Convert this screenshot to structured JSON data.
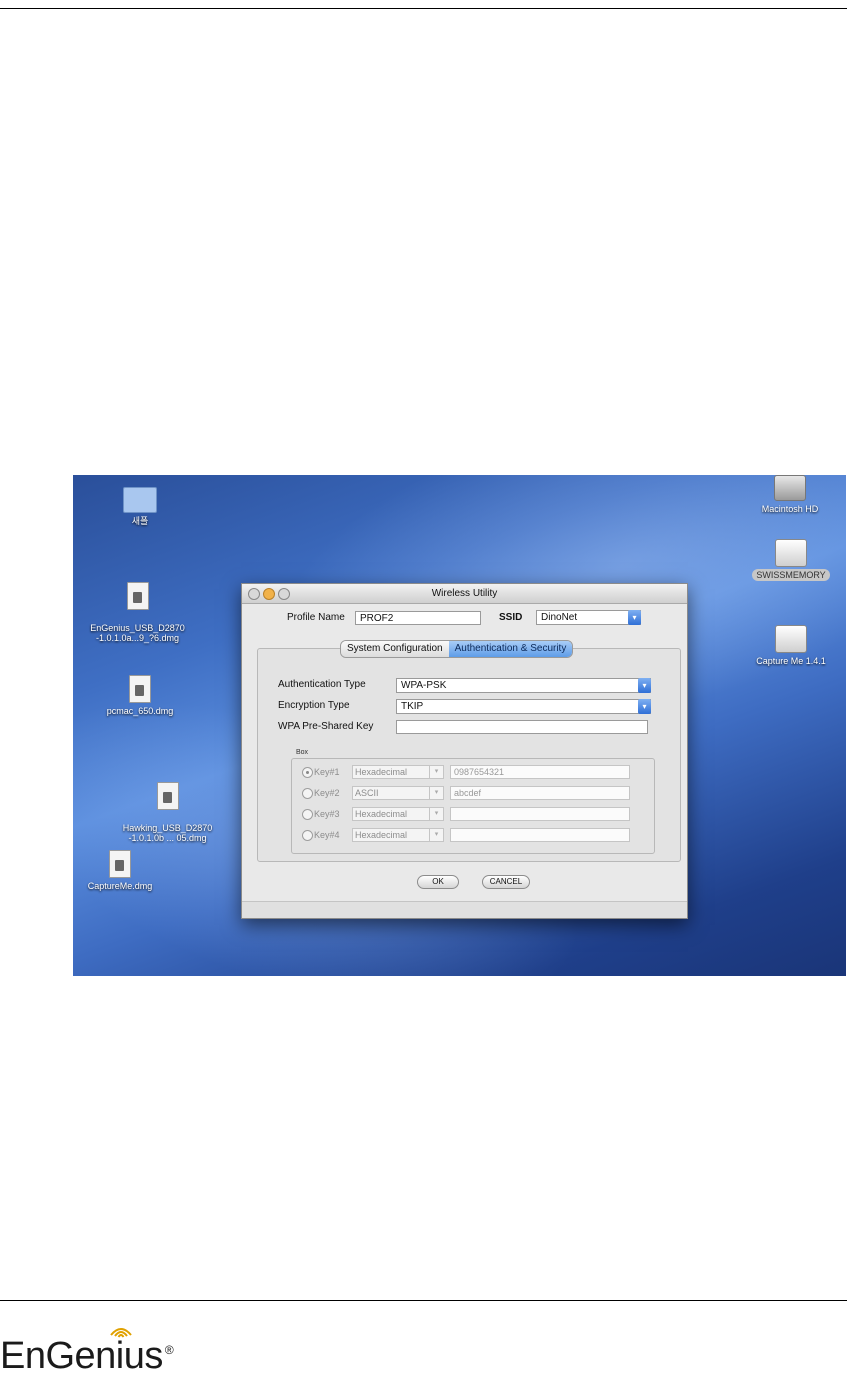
{
  "window": {
    "title": "Wireless Utility",
    "profile_name_label": "Profile Name",
    "profile_name_value": "PROF2",
    "ssid_label": "SSID",
    "ssid_value": "DinoNet",
    "tabs": [
      {
        "label": "System Configuration",
        "active": false
      },
      {
        "label": "Authentication & Security",
        "active": true
      }
    ],
    "auth_type_label": "Authentication Type",
    "auth_type_value": "WPA-PSK",
    "encryption_type_label": "Encryption Type",
    "encryption_type_value": "TKIP",
    "psk_label": "WPA Pre-Shared Key",
    "psk_value": "",
    "box_label": "Box",
    "keys": [
      {
        "label": "Key#1",
        "format": "Hexadecimal",
        "value": "0987654321",
        "selected": true
      },
      {
        "label": "Key#2",
        "format": "ASCII",
        "value": "abcdef",
        "selected": false
      },
      {
        "label": "Key#3",
        "format": "Hexadecimal",
        "value": "",
        "selected": false
      },
      {
        "label": "Key#4",
        "format": "Hexadecimal",
        "value": "",
        "selected": false
      }
    ],
    "ok_label": "OK",
    "cancel_label": "CANCEL"
  },
  "desktop_icons": {
    "folder": "새폴",
    "engenius_dmg": "EnGenius_USB_D2870\n-1.0.1.0a...9_?6.dmg",
    "pcmac_dmg": "pcmac_650.dmg",
    "hawking_dmg": "Hawking_USB_D2870\n-1.0.1.0b ... 05.dmg",
    "capture_dmg": "CaptureMe.dmg",
    "macintosh_hd": "Macintosh HD",
    "swissmemory": "SWISSMEMORY",
    "capture_me": "Capture Me 1.4.1"
  },
  "footer": {
    "brand": "EnGenius",
    "reg_mark": "®"
  },
  "colors": {
    "desktop_blue": "#3f6fc4",
    "selected_tab": "#5e9ce8",
    "traffic_minimize": "#f1b24a"
  }
}
